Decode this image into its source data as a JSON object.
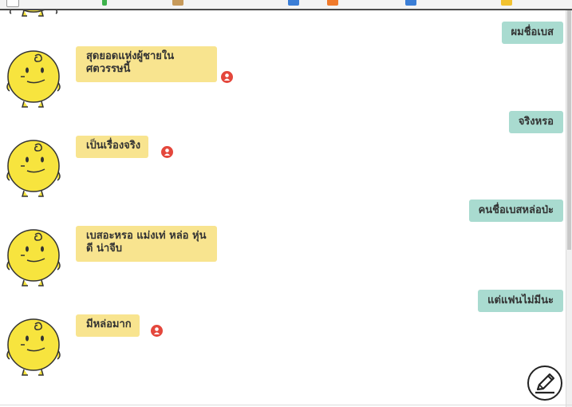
{
  "colors": {
    "bot_bubble": "#f8e48f",
    "user_bubble": "#a9dbd0",
    "report_icon": "#e4473c",
    "avatar_yellow": "#f7e43e"
  },
  "messages": [
    {
      "from": "user",
      "text": "ผมชื่อเบส"
    },
    {
      "from": "bot",
      "text": "สุดยอดแห่งผู้ชายในศตวรรษนี้"
    },
    {
      "from": "user",
      "text": "จริงหรอ"
    },
    {
      "from": "bot",
      "text": "เป็นเรื่องจริง"
    },
    {
      "from": "user",
      "text": "คนชื่อเบสหล่อป่ะ"
    },
    {
      "from": "bot",
      "text": "เบสอะหรอ แม่งเท่ หล่อ หุ่นดี น่าจีบ"
    },
    {
      "from": "user",
      "text": "แต่แฟนไม่มีนะ"
    },
    {
      "from": "bot",
      "text": "มีหล่อมาก"
    }
  ],
  "icons": {
    "avatar": "simsimi-avatar-icon",
    "report": "report-icon",
    "edit": "pencil-icon"
  }
}
